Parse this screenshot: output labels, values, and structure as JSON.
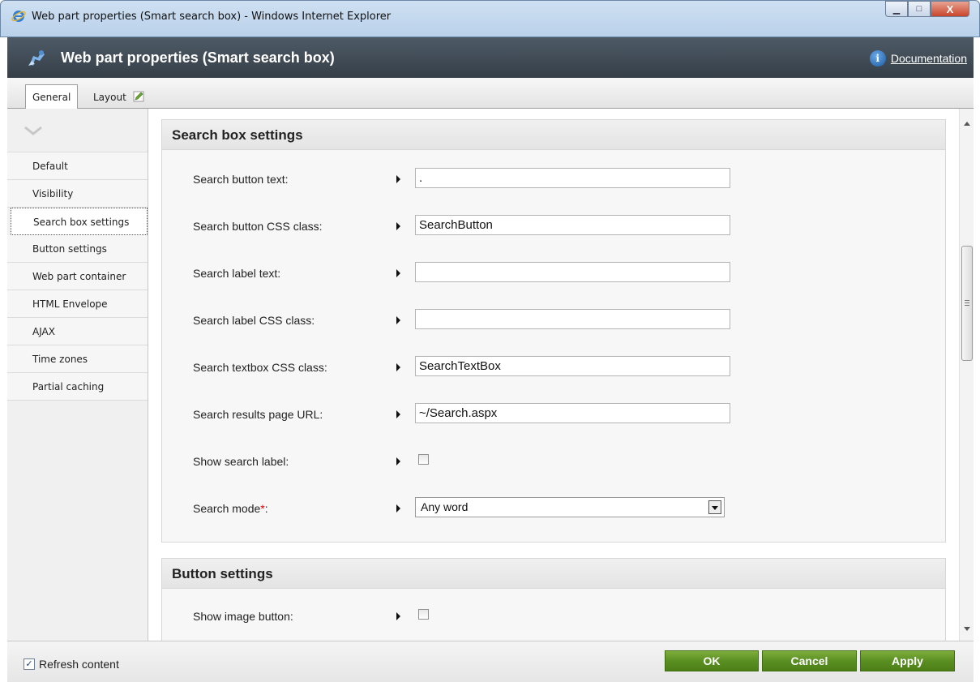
{
  "window": {
    "title": "Web part properties (Smart search box) - Windows Internet Explorer",
    "min_glyph": "▁",
    "max_glyph": "□",
    "close_glyph": "X"
  },
  "header": {
    "title": "Web part properties (Smart search box)",
    "doc_icon_glyph": "i",
    "documentation_label": "Documentation"
  },
  "tabs": [
    {
      "label": "General",
      "active": true
    },
    {
      "label": "Layout",
      "active": false
    }
  ],
  "sidebar": {
    "items": [
      {
        "label": "Default"
      },
      {
        "label": "Visibility"
      },
      {
        "label": "Search box settings",
        "active": true
      },
      {
        "label": "Button settings"
      },
      {
        "label": "Web part container"
      },
      {
        "label": "HTML Envelope"
      },
      {
        "label": "AJAX"
      },
      {
        "label": "Time zones"
      },
      {
        "label": "Partial caching"
      }
    ]
  },
  "search_box_settings": {
    "heading": "Search box settings",
    "fields": {
      "button_text": {
        "label": "Search button text:",
        "value": "."
      },
      "button_css": {
        "label": "Search button CSS class:",
        "value": "SearchButton"
      },
      "label_text": {
        "label": "Search label text:",
        "value": ""
      },
      "label_css": {
        "label": "Search label CSS class:",
        "value": ""
      },
      "textbox_css": {
        "label": "Search textbox CSS class:",
        "value": "SearchTextBox"
      },
      "results_url": {
        "label": "Search results page URL:",
        "value": "~/Search.aspx"
      },
      "show_label": {
        "label": "Show search label:",
        "checked": false
      },
      "search_mode": {
        "label": "Search mode",
        "required_mark": "*",
        "label_suffix": ":",
        "value": "Any word"
      }
    }
  },
  "button_settings": {
    "heading": "Button settings",
    "fields": {
      "show_image_button": {
        "label": "Show image button:",
        "checked": false
      }
    }
  },
  "footer": {
    "refresh_label": "Refresh content",
    "refresh_checked": true,
    "check_glyph": "✓",
    "ok_label": "OK",
    "cancel_label": "Cancel",
    "apply_label": "Apply"
  },
  "colors": {
    "header_bg": "#3d4750",
    "button_green": "#5a8f22",
    "required": "#dd0000"
  }
}
